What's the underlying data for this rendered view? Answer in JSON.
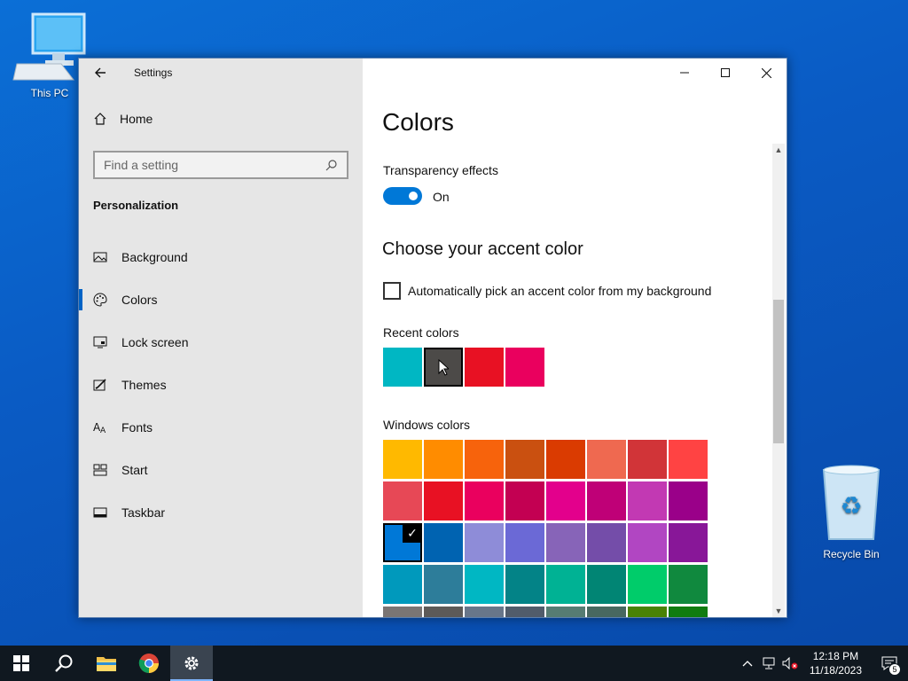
{
  "desktop": {
    "this_pc_label": "This PC",
    "recycle_bin_label": "Recycle Bin"
  },
  "window": {
    "title": "Settings",
    "sidebar": {
      "home_label": "Home",
      "search_placeholder": "Find a setting",
      "section_title": "Personalization",
      "items": [
        {
          "label": "Background",
          "icon": "image-icon",
          "active": false
        },
        {
          "label": "Colors",
          "icon": "palette-icon",
          "active": true
        },
        {
          "label": "Lock screen",
          "icon": "lock-screen-icon",
          "active": false
        },
        {
          "label": "Themes",
          "icon": "brush-icon",
          "active": false
        },
        {
          "label": "Fonts",
          "icon": "font-icon",
          "active": false
        },
        {
          "label": "Start",
          "icon": "start-grid-icon",
          "active": false
        },
        {
          "label": "Taskbar",
          "icon": "taskbar-icon",
          "active": false
        }
      ]
    },
    "main": {
      "page_title": "Colors",
      "transparency_label": "Transparency effects",
      "transparency_state": "On",
      "transparency_on": true,
      "accent_heading": "Choose your accent color",
      "auto_pick_label": "Automatically pick an accent color from my background",
      "auto_pick_checked": false,
      "recent_label": "Recent colors",
      "recent_colors": [
        "#00b7c3",
        "#4c4a48",
        "#e81123",
        "#ea005e"
      ],
      "recent_selected_index": 1,
      "windows_label": "Windows colors",
      "windows_colors": [
        [
          "#ffb900",
          "#ff8c00",
          "#f7630c",
          "#ca5010",
          "#da3b01",
          "#ef6950",
          "#d13438",
          "#ff4343"
        ],
        [
          "#e74856",
          "#e81123",
          "#ea005e",
          "#c30052",
          "#e3008c",
          "#bf0077",
          "#c239b3",
          "#9a0089"
        ],
        [
          "#0078d7",
          "#0063b1",
          "#8e8cd8",
          "#6b69d6",
          "#8764b8",
          "#744da9",
          "#b146c2",
          "#881798"
        ],
        [
          "#0099bc",
          "#2d7d9a",
          "#00b7c3",
          "#038387",
          "#00b294",
          "#018574",
          "#00cc6a",
          "#10893e"
        ],
        [
          "#7a7574",
          "#5d5a58",
          "#68768a",
          "#515c6b",
          "#567c73",
          "#486860",
          "#498205",
          "#107c10"
        ]
      ],
      "windows_selected": [
        2,
        0
      ],
      "check_glyph": "✓"
    }
  },
  "taskbar": {
    "time": "12:18 PM",
    "date": "11/18/2023",
    "notification_count": "5"
  }
}
